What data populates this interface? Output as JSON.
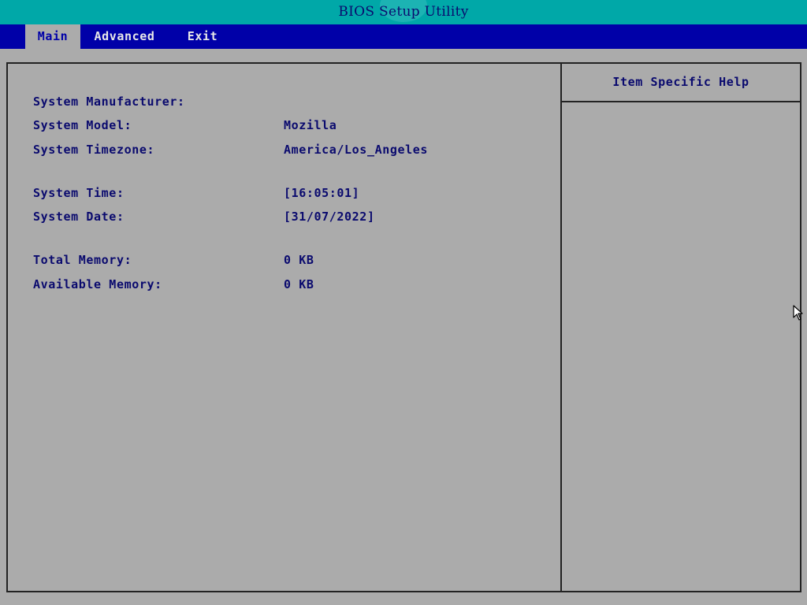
{
  "window": {
    "title": "BIOS Setup Utility"
  },
  "tabs": [
    {
      "label": "Main"
    },
    {
      "label": "Advanced"
    },
    {
      "label": "Exit"
    }
  ],
  "main": {
    "system_manufacturer": {
      "label": "System Manufacturer:",
      "value": ""
    },
    "system_model": {
      "label": "System Model:",
      "value": "Mozilla"
    },
    "system_timezone": {
      "label": "System Timezone:",
      "value": "America/Los_Angeles"
    },
    "system_time": {
      "label": "System Time:",
      "value": "[16:05:01]"
    },
    "system_date": {
      "label": "System Date:",
      "value": "[31/07/2022]"
    },
    "total_memory": {
      "label": "Total Memory:",
      "value": "0 KB"
    },
    "available_memory": {
      "label": "Available Memory:",
      "value": "0 KB"
    }
  },
  "help": {
    "title": "Item Specific Help",
    "text": ""
  },
  "colors": {
    "title_bar": "#00a8a8",
    "menu_bar": "#0000a8",
    "background": "#ababab",
    "text": "#0a0a6e"
  },
  "icons": {
    "cursor": "mouse-pointer-icon"
  }
}
